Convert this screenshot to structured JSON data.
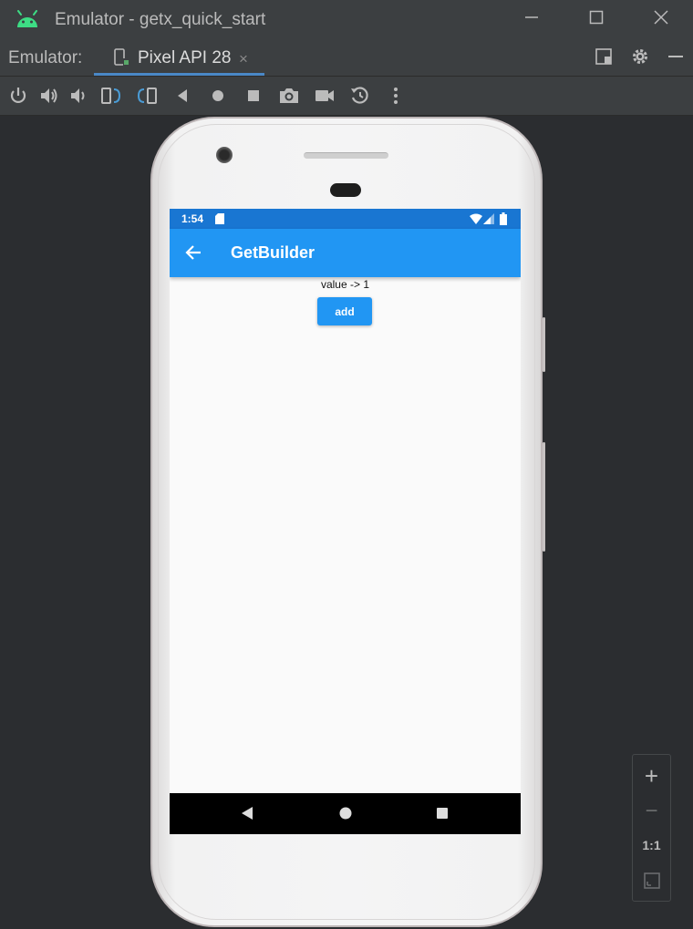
{
  "window": {
    "title": "Emulator - getx_quick_start"
  },
  "tabbar": {
    "label": "Emulator:",
    "tab_label": "Pixel API 28",
    "tab_close": "×"
  },
  "device": {
    "status_time": "1:54",
    "appbar_title": "GetBuilder",
    "value_text": "value -> 1",
    "add_label": "add"
  },
  "zoom": {
    "zoom_in": "+",
    "zoom_out": "−",
    "actual_size": "1:1"
  },
  "colors": {
    "status_bar": "#1976d2",
    "app_bar": "#2196f3",
    "ide_background": "#2b2d30",
    "ide_chrome": "#3c3f41"
  },
  "icons": [
    "android-icon",
    "minimize-icon",
    "maximize-icon",
    "close-icon",
    "device-icon",
    "layout-icon",
    "gear-icon",
    "hide-icon",
    "power-icon",
    "volume-up-icon",
    "volume-down-icon",
    "rotate-left-icon",
    "rotate-right-icon",
    "back-icon",
    "home-icon",
    "overview-icon",
    "screenshot-icon",
    "record-icon",
    "snapshot-icon",
    "more-icon",
    "arrow-back-icon",
    "sd-card-icon",
    "wifi-icon",
    "signal-icon",
    "battery-icon",
    "fit-screen-icon"
  ]
}
